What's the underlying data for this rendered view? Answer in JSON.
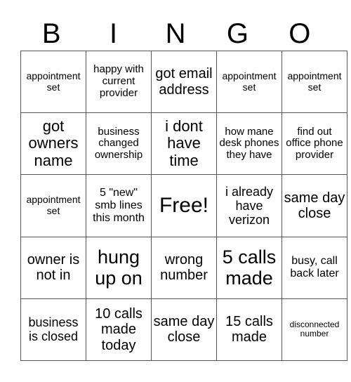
{
  "header": [
    "B",
    "I",
    "N",
    "G",
    "O"
  ],
  "rows": [
    [
      "appointment set",
      "happy with current provider",
      "got email address",
      "appointment set",
      "appointment set"
    ],
    [
      "got owners name",
      "business changed ownership",
      "i dont have time",
      "how mane desk phones they have",
      "find out office phone provider"
    ],
    [
      "appointment set",
      "5 \"new\" smb lines this month",
      "Free!",
      "i already have verizon",
      "same day close"
    ],
    [
      "owner is not in",
      "hung up on",
      "wrong number",
      "5 calls made",
      "busy, call back later"
    ],
    [
      "business is closed",
      "10 calls made today",
      "same day close",
      "15 calls made",
      "disconnected number"
    ]
  ]
}
